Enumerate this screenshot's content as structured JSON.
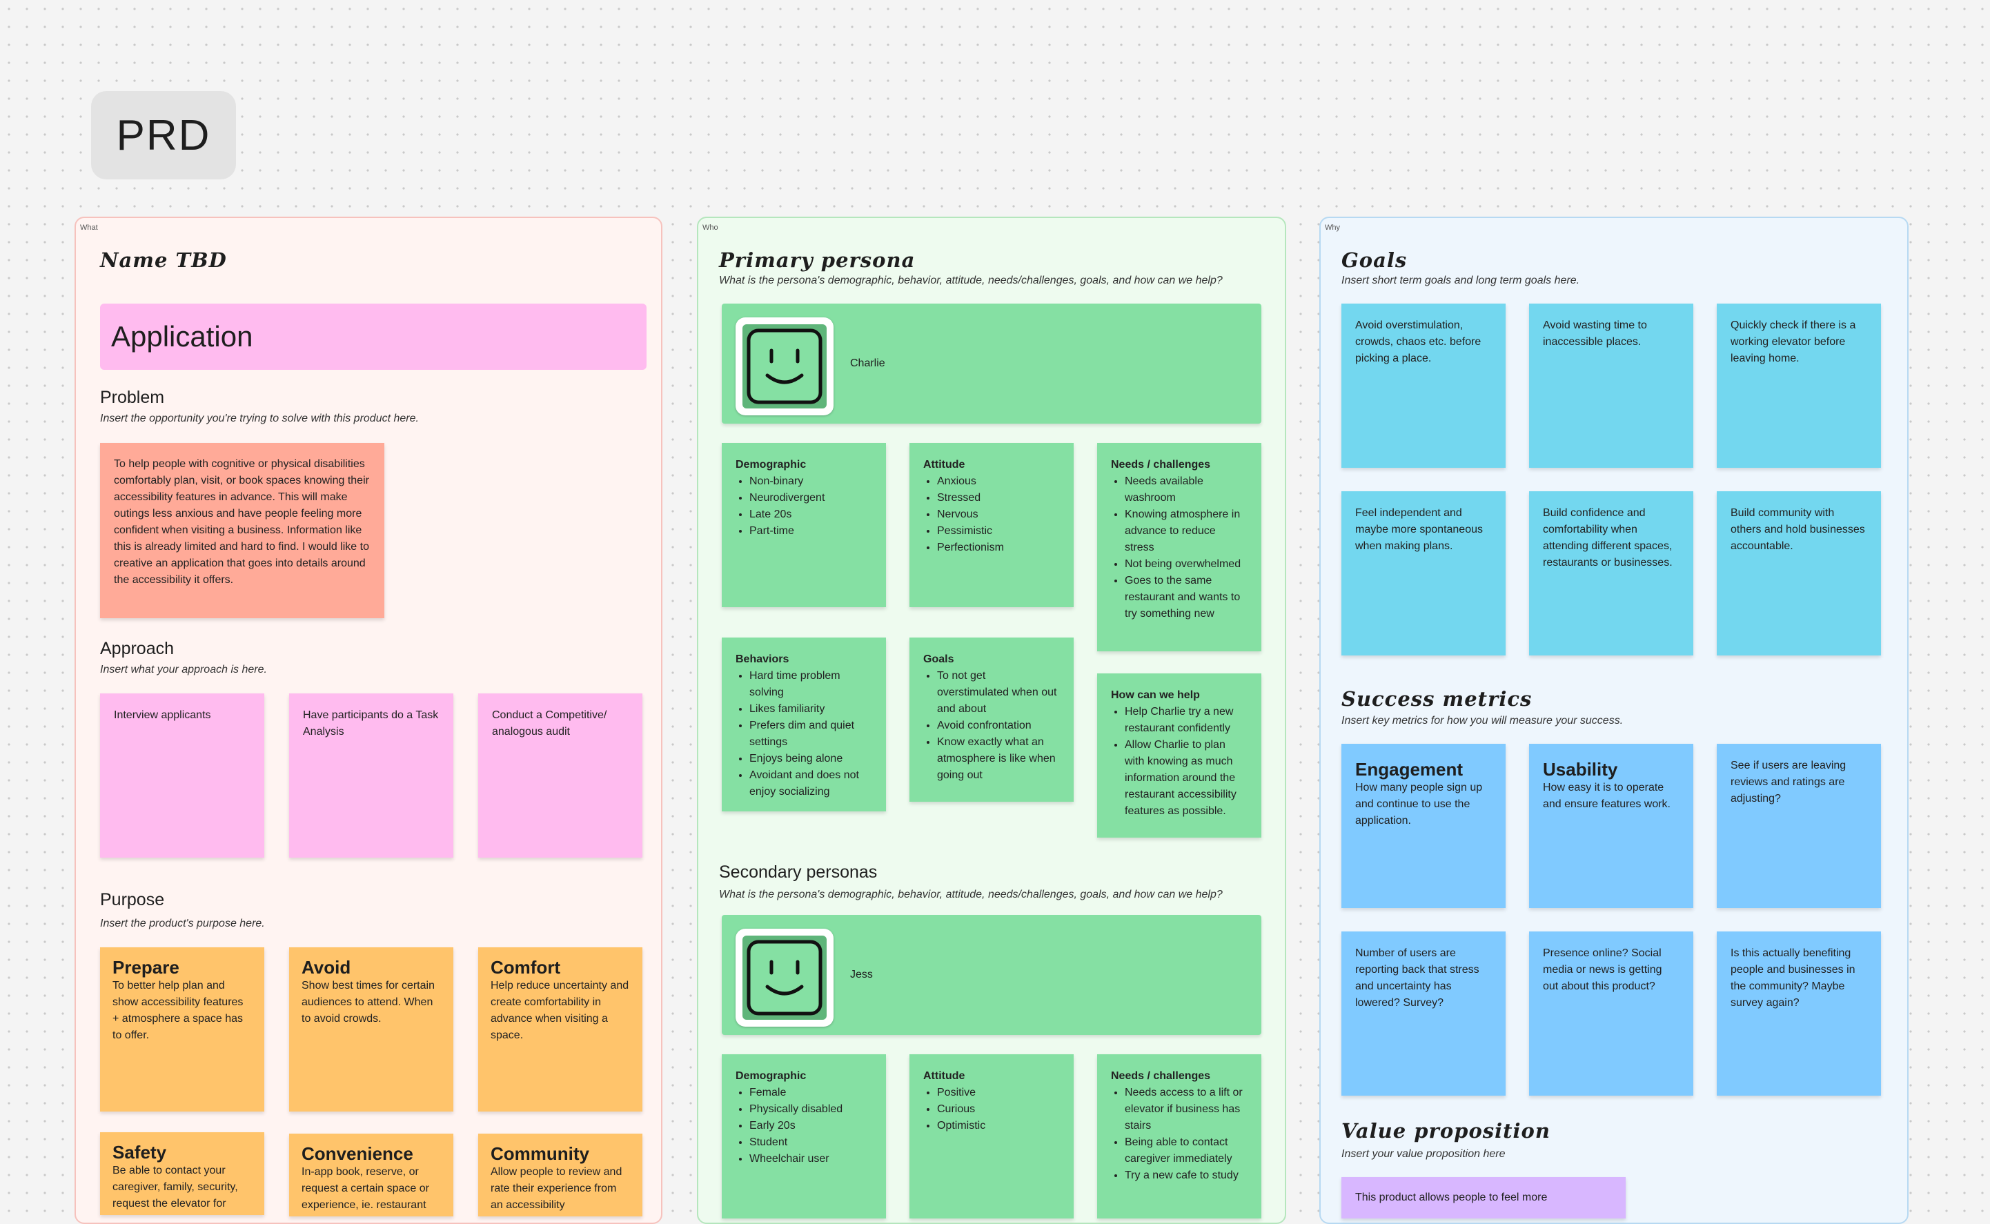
{
  "header": {
    "title": "PRD"
  },
  "what": {
    "section_label": "What",
    "name_title": "Name TBD",
    "app_banner": "Application",
    "problem": {
      "heading": "Problem",
      "instruction": "Insert the opportunity you're trying to solve with this product here.",
      "note": "To help people with cognitive or physical disabilities comfortably plan, visit, or book spaces knowing their accessibility features in advance. This will make outings less anxious and have people feeling more confident when visiting a business. Information like this is already limited and hard to find. I would like to creative an application that goes into details around the accessibility it offers."
    },
    "approach": {
      "heading": "Approach",
      "instruction": "Insert what your approach is here.",
      "notes": [
        "Interview applicants",
        "Have participants do a Task Analysis",
        "Conduct a Competitive/ analogous audit"
      ]
    },
    "purpose": {
      "heading": "Purpose",
      "instruction": "Insert the product's purpose here.",
      "notes": [
        {
          "title": "Prepare",
          "body": "To better help plan and show accessibility features + atmosphere a space has to offer."
        },
        {
          "title": "Avoid",
          "body": "Show best times for certain audiences to attend. When to avoid crowds."
        },
        {
          "title": "Comfort",
          "body": "Help reduce uncertainty and create comfortability in advance when visiting a space."
        },
        {
          "title": "Safety",
          "body": "Be able to contact your caregiver, family, security, request the elevator for"
        },
        {
          "title": "Convenience",
          "body": "In-app book, reserve, or request a certain space or experience, ie. restaurant"
        },
        {
          "title": "Community",
          "body": "Allow people to review and rate their experience from an accessibility"
        }
      ]
    }
  },
  "who": {
    "section_label": "Who",
    "primary_title": "Primary persona",
    "primary_instruction": "What is the persona's demographic, behavior, attitude, needs/challenges, goals, and how can we help?",
    "primary_name": "Charlie",
    "primary_demographic": {
      "title": "Demographic",
      "items": [
        "Non-binary",
        "Neurodivergent",
        "Late 20s",
        "Part-time"
      ]
    },
    "primary_attitude": {
      "title": "Attitude",
      "items": [
        "Anxious",
        "Stressed",
        "Nervous",
        "Pessimistic",
        "Perfectionism"
      ]
    },
    "primary_needs": {
      "title": "Needs / challenges",
      "items": [
        "Needs available washroom",
        "Knowing atmosphere in advance to reduce stress",
        "Not being overwhelmed",
        "Goes to the same restaurant and wants to try something new"
      ]
    },
    "primary_behaviors": {
      "title": "Behaviors",
      "items": [
        "Hard time problem solving",
        "Likes familiarity",
        "Prefers dim and quiet settings",
        "Enjoys being alone",
        "Avoidant and does not enjoy socializing"
      ]
    },
    "primary_goals": {
      "title": "Goals",
      "items": [
        "To not get overstimulated when out and about",
        "Avoid confrontation",
        "Know exactly what an atmosphere is like when going out"
      ]
    },
    "primary_help": {
      "title": "How can we help",
      "items": [
        "Help Charlie try a new restaurant confidently",
        "Allow Charlie to plan with knowing as much information around the restaurant accessibility features as possible."
      ]
    },
    "secondary_heading": "Secondary personas",
    "secondary_instruction": "What is the persona's demographic, behavior, attitude, needs/challenges, goals, and how can we help?",
    "secondary_name": "Jess",
    "secondary_demographic": {
      "title": "Demographic",
      "items": [
        "Female",
        "Physically disabled",
        "Early 20s",
        "Student",
        "Wheelchair user"
      ]
    },
    "secondary_attitude": {
      "title": "Attitude",
      "items": [
        "Positive",
        "Curious",
        "Optimistic"
      ]
    },
    "secondary_needs": {
      "title": "Needs / challenges",
      "items": [
        "Needs access to a lift or elevator if business has stairs",
        "Being able to contact caregiver immediately",
        "Try a new cafe to study"
      ]
    }
  },
  "why": {
    "section_label": "Why",
    "goals_title": "Goals",
    "goals_instruction": "Insert short term goals and long term goals here.",
    "goals": [
      "Avoid overstimulation, crowds, chaos etc. before picking a place.",
      "Avoid wasting time to inaccessible places.",
      "Quickly check if there is a working elevator before leaving home.",
      "Feel independent and maybe more spontaneous when making plans.",
      "Build confidence and comfortability when attending different spaces, restaurants or businesses.",
      "Build community with others and hold businesses accountable."
    ],
    "metrics_title": "Success metrics",
    "metrics_instruction": "Insert key metrics for how you will measure your success.",
    "metrics": [
      {
        "title": "Engagement",
        "body": "How many people sign up and continue to use the application."
      },
      {
        "title": "Usability",
        "body": "How easy it is to operate and ensure features work."
      },
      {
        "title": "",
        "body": "See if users are leaving reviews and ratings are adjusting?"
      },
      {
        "title": "",
        "body": "Number of users are reporting back that stress and uncertainty has lowered? Survey?"
      },
      {
        "title": "",
        "body": "Presence online? Social media or news is getting out about this product?"
      },
      {
        "title": "",
        "body": "Is this actually benefiting people and businesses in the community? Maybe survey again?"
      }
    ],
    "value_title": "Value proposition",
    "value_instruction": "Insert your value proposition here",
    "value_note": "This product allows people to feel more"
  },
  "colors": {
    "pink": "#ffbbef",
    "salmon": "#ffaa98",
    "orange": "#ffc46b",
    "green": "#85e0a3",
    "cyan": "#73d7ef",
    "blue": "#80caff",
    "purple": "#d8b7ff"
  }
}
